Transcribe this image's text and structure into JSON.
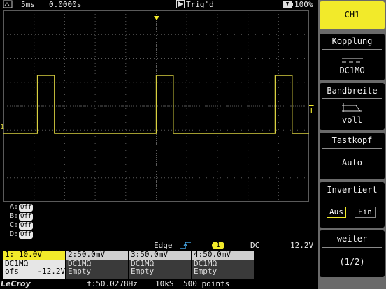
{
  "topbar": {
    "timebase": "5ms",
    "delay": "0.0000s",
    "trigger_state": "Trig'd",
    "battery": "100%"
  },
  "panel": {
    "channel": "CH1",
    "coupling_title": "Kopplung",
    "coupling_value": "DC1MΩ",
    "bandwidth_title": "Bandbreite",
    "bandwidth_value": "voll",
    "probe_title": "Tastkopf",
    "probe_value": "Auto",
    "invert_title": "Invertiert",
    "invert_off": "Aus",
    "invert_on": "Ein",
    "more_title": "weiter",
    "more_page": "(1/2)"
  },
  "traces": [
    {
      "label": "A:",
      "state": "Off"
    },
    {
      "label": "B:",
      "state": "Off"
    },
    {
      "label": "C:",
      "state": "Off"
    },
    {
      "label": "D:",
      "state": "Off"
    }
  ],
  "trigger": {
    "type": "Edge",
    "source": "1",
    "coupling": "DC",
    "level": "12.2V"
  },
  "markers": {
    "ch1_ground": "1",
    "trigger_level": "T"
  },
  "channels": [
    {
      "header": "1: 10.0V",
      "coupling": "DC1MΩ",
      "line3_label": "ofs",
      "line3_value": "-12.2V"
    },
    {
      "header": "2:50.0mV",
      "coupling": "DC1MΩ",
      "line3_label": "Empty",
      "line3_value": ""
    },
    {
      "header": "3:50.0mV",
      "coupling": "DC1MΩ",
      "line3_label": "Empty",
      "line3_value": ""
    },
    {
      "header": "4:50.0mV",
      "coupling": "DC1MΩ",
      "line3_label": "Empty",
      "line3_value": ""
    }
  ],
  "status": {
    "brand": "LeCroy",
    "frequency": "f:50.0278Hz",
    "sample_rate": "10kS",
    "points": "500 points"
  },
  "colors": {
    "ch1": "#d8d040",
    "accent_yellow": "#f2ea2a",
    "grid": "#5a5a5a"
  },
  "chart_data": {
    "type": "line",
    "series": [
      {
        "values": [
          0,
          0,
          1,
          0,
          0,
          0,
          0,
          0,
          0,
          1,
          0,
          0,
          0,
          0,
          0,
          0,
          1,
          0
        ]
      }
    ]
  }
}
